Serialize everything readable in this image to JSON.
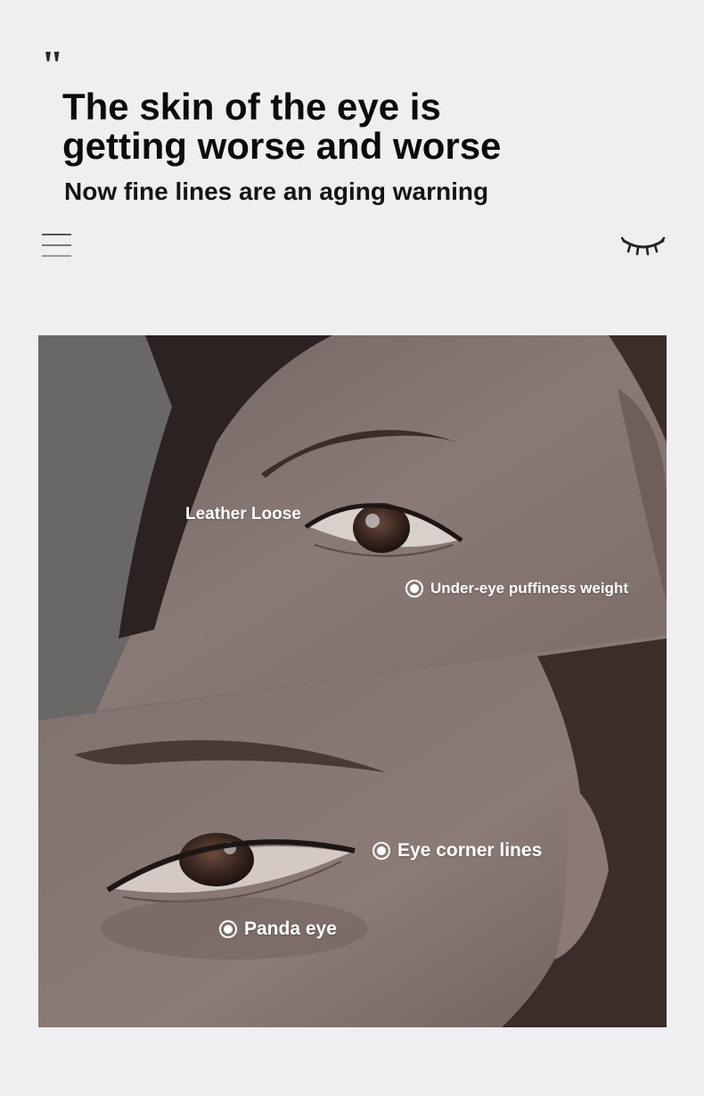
{
  "header": {
    "quote_mark": "\"",
    "title_line1": "The skin of the eye is",
    "title_line2": "getting worse and worse",
    "subtitle": "Now fine lines are an aging warning"
  },
  "icons": {
    "menu": "menu-lines-icon",
    "lash": "closed-eye-lash-icon"
  },
  "callouts": {
    "leather_loose": "Leather Loose",
    "under_eye": "Under-eye puffiness weight",
    "eye_corner": "Eye corner lines",
    "panda_eye": "Panda eye"
  },
  "colors": {
    "background": "#efeff1",
    "text": "#0b0b0b",
    "callout_text": "#ffffff"
  }
}
